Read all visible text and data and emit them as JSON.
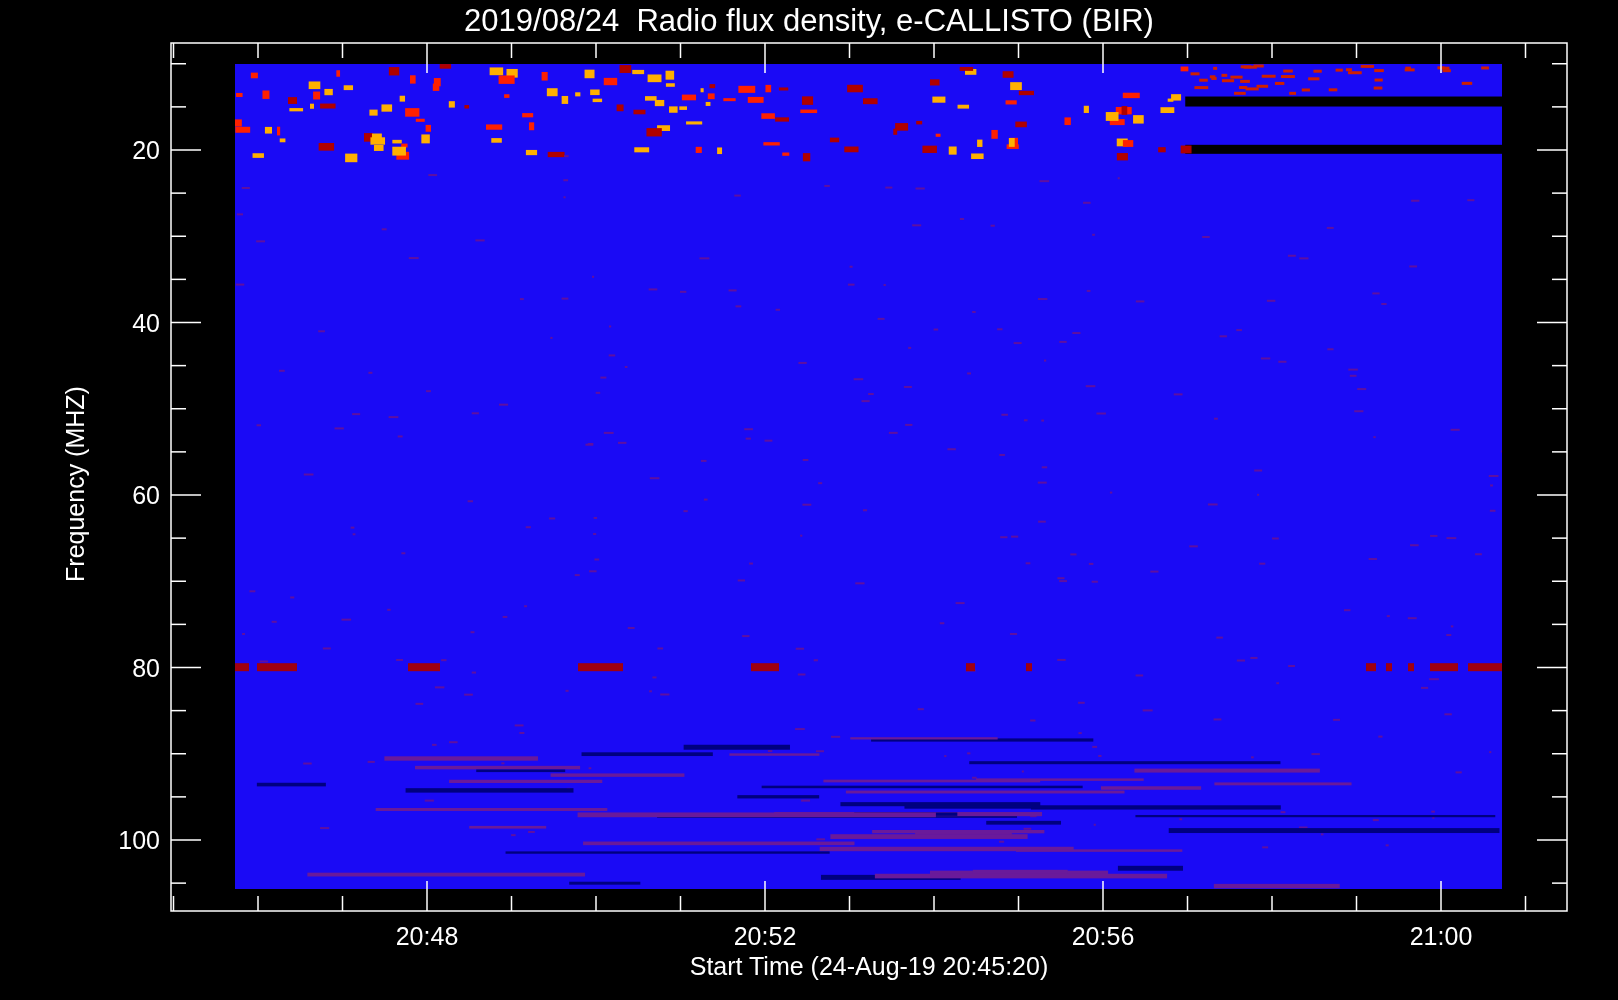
{
  "title": "2019/08/24  Radio flux density, e-CALLISTO (BIR)",
  "y_axis": {
    "label": "Frequency (MHZ)",
    "ticks": [
      "20",
      "40",
      "60",
      "80",
      "100"
    ]
  },
  "x_axis": {
    "label": "Start Time (24-Aug-19 20:45:20)",
    "ticks": [
      "20:48",
      "20:52",
      "20:56",
      "21:00"
    ]
  }
}
